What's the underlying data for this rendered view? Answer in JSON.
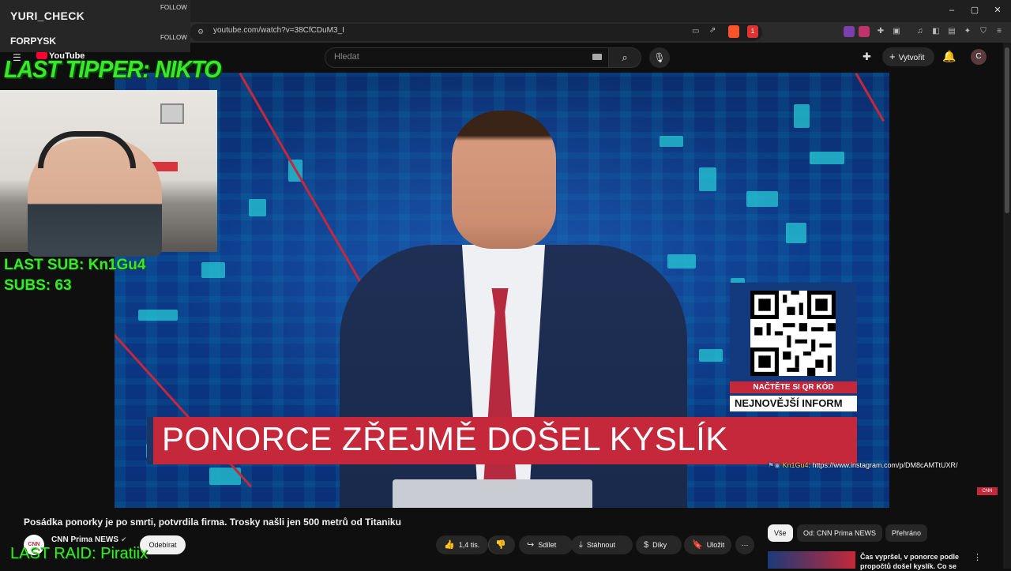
{
  "browser": {
    "url": "youtube.com/watch?v=38CfCDuM3_I",
    "window_controls": [
      "–",
      "▢",
      "✕"
    ],
    "brave_badge": "1"
  },
  "youtube": {
    "logo": "YouTube",
    "search_placeholder": "Hledat",
    "create_label": "Vytvořit",
    "avatar_letter": "C"
  },
  "video": {
    "headline": "PONORCE ZŘEJMĚ DOŠEL KYSLÍK",
    "qr_cta": "NAČTĚTE SI QR KÓD",
    "qr_news": "NEJNOVĚJŠÍ INFORM",
    "chat_user": "Kn1Gu4",
    "chat_message": ": https://www.instagram.com/p/DM8cAMTtUXR/",
    "channel_bug": "CNN",
    "title": "Posádka ponorky je po smrti, potvrdila firma. Trosky našli jen 500 metrů od Titaniku"
  },
  "channel": {
    "name": "CNN Prima NEWS",
    "subscribe_label": "Odebírat",
    "logo_text": "CNN"
  },
  "actions": {
    "likes": "1,4 tis.",
    "share": "Sdílet",
    "download": "Stáhnout",
    "thanks": "Díky",
    "save": "Uložit",
    "more": "⋯"
  },
  "sidebar": {
    "chips": [
      "Vše",
      "Od: CNN Prima NEWS",
      "Přehráno"
    ],
    "rec_title": "Čas vypršel, v ponorce podle propočtů došel kyslík. Co se"
  },
  "overlay": {
    "follow_user_1": "YURI_CHECK",
    "follow_user_2": "FORPYSK",
    "follow_label": "FOLLOW",
    "last_tipper": "LAST TIPPER: NIKTO",
    "last_sub": "LAST SUB: Kn1Gu4",
    "subs": "SUBS: 63",
    "last_raid": "LAST RAID: Piratiix"
  },
  "colors": {
    "overlay_green": "#39e82b",
    "headline_red": "#c4283a",
    "youtube_red": "#ff0033"
  }
}
